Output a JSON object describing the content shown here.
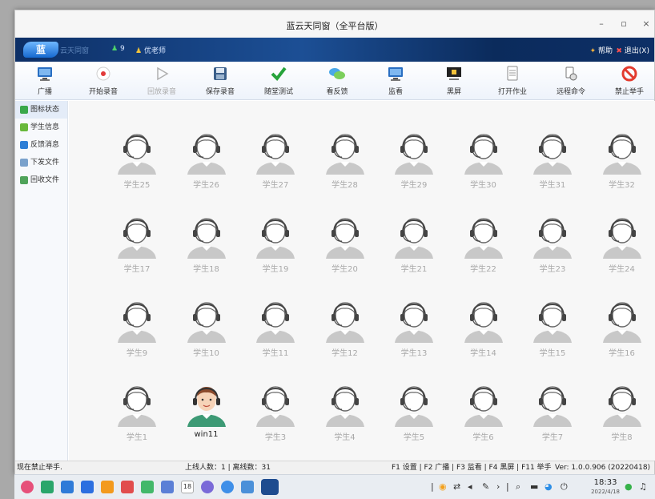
{
  "window": {
    "title": "蓝云天同窗（全平台版）",
    "minimize": "–",
    "maximize": "▫",
    "close": "×"
  },
  "banner": {
    "logo": "蓝",
    "logo_sub": "云天同窗",
    "user_count": "9",
    "teacher": "优老师",
    "help": "帮助",
    "exit": "退出(X)"
  },
  "toolbar": [
    {
      "label": "广播",
      "icon": "monitor-icon",
      "enabled": true
    },
    {
      "label": "开始录音",
      "icon": "record-icon",
      "enabled": true
    },
    {
      "label": "回放录音",
      "icon": "play-icon",
      "enabled": false
    },
    {
      "label": "保存录音",
      "icon": "save-icon",
      "enabled": true
    },
    {
      "label": "随堂测试",
      "icon": "checkmark-icon",
      "enabled": true
    },
    {
      "label": "看反馈",
      "icon": "chat-bubble-icon",
      "enabled": true
    },
    {
      "label": "监看",
      "icon": "monitor-icon",
      "enabled": true
    },
    {
      "label": "黑屏",
      "icon": "lock-screen-icon",
      "enabled": true
    },
    {
      "label": "打开作业",
      "icon": "document-icon",
      "enabled": true
    },
    {
      "label": "远程命令",
      "icon": "remote-command-icon",
      "enabled": true
    },
    {
      "label": "禁止举手",
      "icon": "forbidden-icon",
      "enabled": true
    }
  ],
  "sidebar": [
    {
      "label": "图标状态",
      "icon": "person-icon",
      "active": true
    },
    {
      "label": "学生信息",
      "icon": "info-icon",
      "active": false
    },
    {
      "label": "反馈消息",
      "icon": "message-icon",
      "active": false
    },
    {
      "label": "下发文件",
      "icon": "send-file-icon",
      "active": false
    },
    {
      "label": "回收文件",
      "icon": "collect-file-icon",
      "active": false
    }
  ],
  "students": [
    {
      "name": "学生25",
      "online": false
    },
    {
      "name": "学生26",
      "online": false
    },
    {
      "name": "学生27",
      "online": false
    },
    {
      "name": "学生28",
      "online": false
    },
    {
      "name": "学生29",
      "online": false
    },
    {
      "name": "学生30",
      "online": false
    },
    {
      "name": "学生31",
      "online": false
    },
    {
      "name": "学生32",
      "online": false
    },
    {
      "name": "学生17",
      "online": false
    },
    {
      "name": "学生18",
      "online": false
    },
    {
      "name": "学生19",
      "online": false
    },
    {
      "name": "学生20",
      "online": false
    },
    {
      "name": "学生21",
      "online": false
    },
    {
      "name": "学生22",
      "online": false
    },
    {
      "name": "学生23",
      "online": false
    },
    {
      "name": "学生24",
      "online": false
    },
    {
      "name": "学生9",
      "online": false
    },
    {
      "name": "学生10",
      "online": false
    },
    {
      "name": "学生11",
      "online": false
    },
    {
      "name": "学生12",
      "online": false
    },
    {
      "name": "学生13",
      "online": false
    },
    {
      "name": "学生14",
      "online": false
    },
    {
      "name": "学生15",
      "online": false
    },
    {
      "name": "学生16",
      "online": false
    },
    {
      "name": "学生1",
      "online": false
    },
    {
      "name": "win11",
      "online": true
    },
    {
      "name": "学生3",
      "online": false
    },
    {
      "name": "学生4",
      "online": false
    },
    {
      "name": "学生5",
      "online": false
    },
    {
      "name": "学生6",
      "online": false
    },
    {
      "name": "学生7",
      "online": false
    },
    {
      "name": "学生8",
      "online": false
    }
  ],
  "status": {
    "left": "现在禁止举手.",
    "counts": "上线人数：1 | 离线数：31",
    "shortcuts": "F1 设置 | F2 广播 | F3 监看 | F4 黑屏 | F11 举手",
    "version": "Ver: 1.0.0.906 (20220418)"
  },
  "taskbar": {
    "time": "18:33",
    "date": "2022/4/18",
    "app_icons": [
      "launcher-icon",
      "terminal-icon",
      "app-store-icon",
      "browser-icon",
      "files-icon",
      "image-viewer-icon",
      "music-icon",
      "document-viewer-icon",
      "calendar-icon",
      "settings-icon",
      "camera-icon",
      "cloud-icon",
      "classroom-app-icon"
    ],
    "calendar_day": "18"
  }
}
